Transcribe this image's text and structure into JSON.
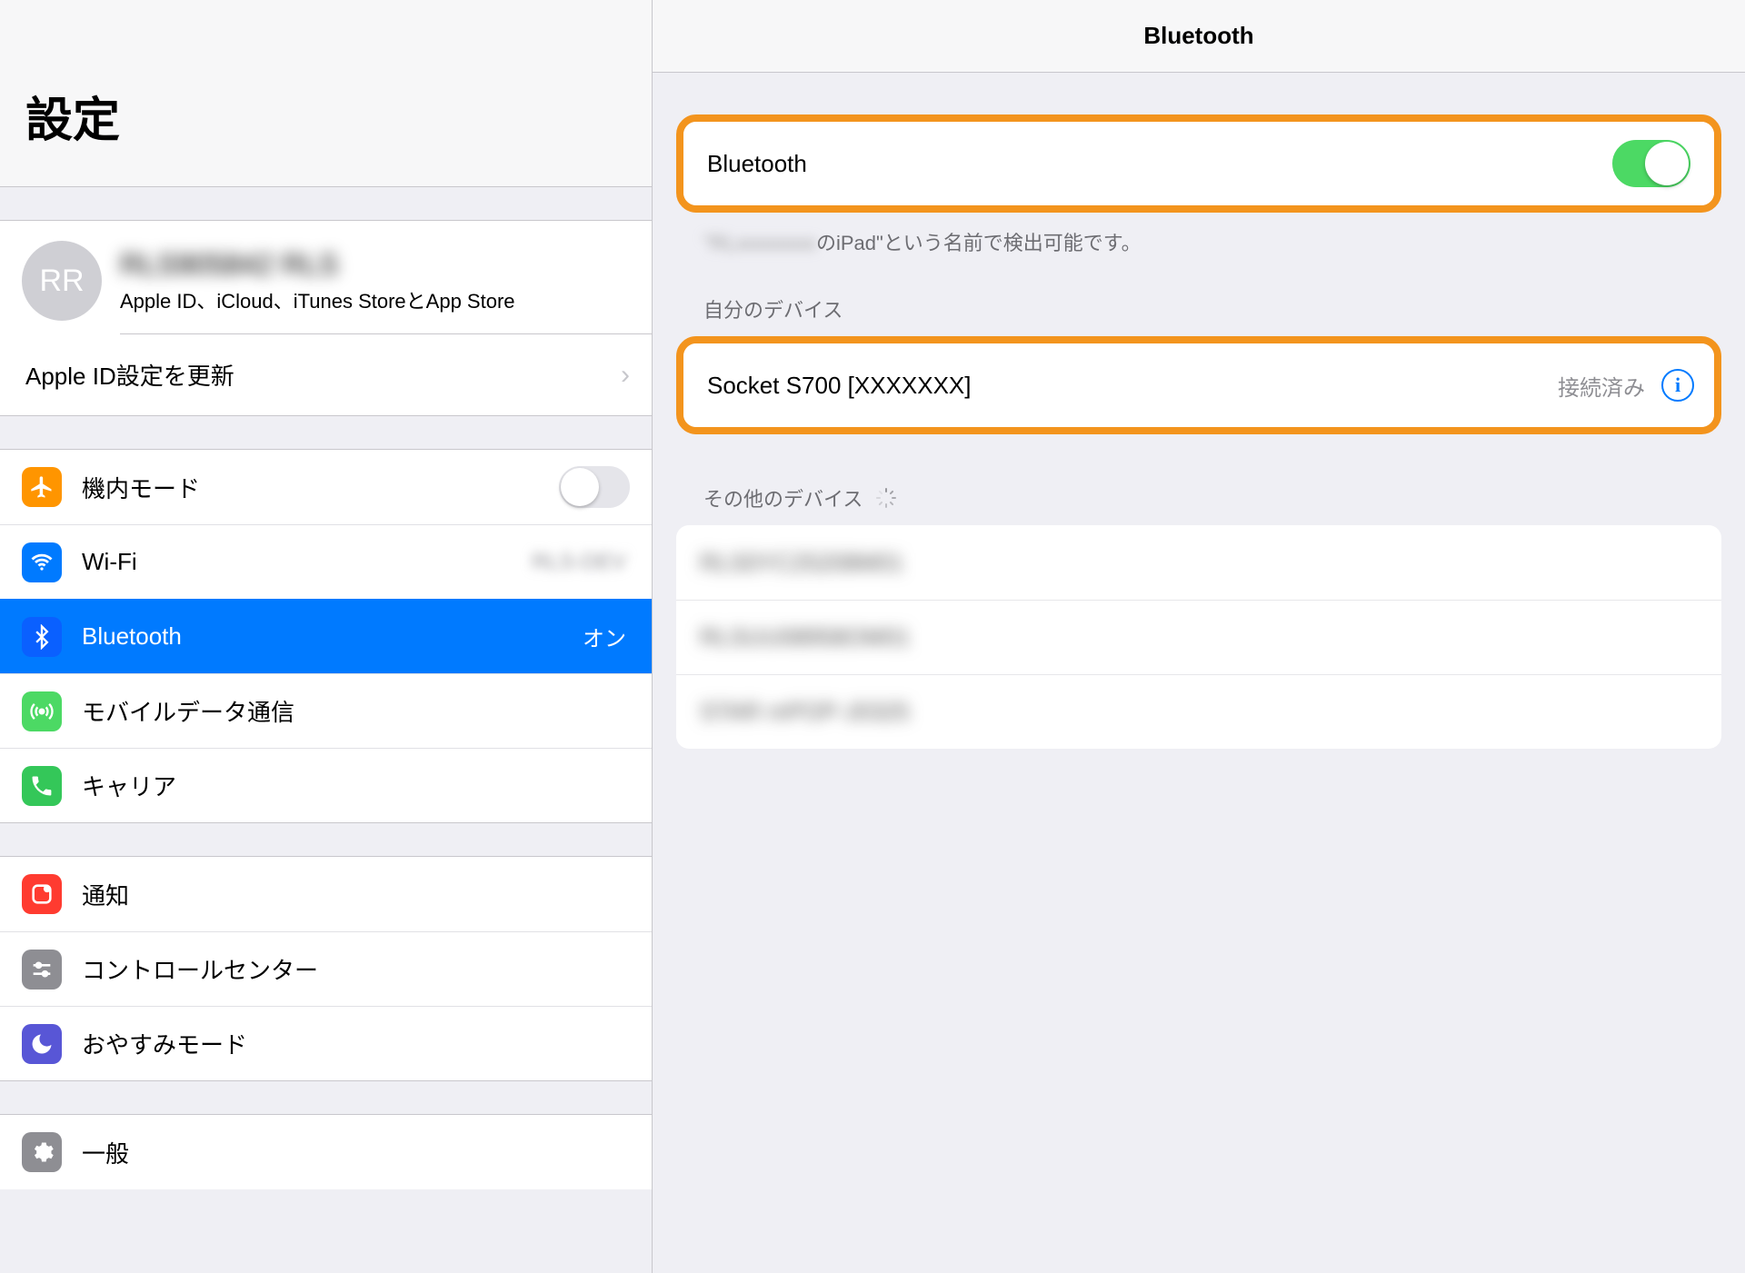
{
  "sidebar": {
    "title": "設定",
    "account": {
      "initials": "RR",
      "name": "RLS905842 RLS",
      "subtitle": "Apple ID、iCloud、iTunes StoreとApp Store",
      "update_label": "Apple ID設定を更新"
    },
    "group1": {
      "airplane": {
        "label": "機内モード",
        "on": false
      },
      "wifi": {
        "label": "Wi-Fi",
        "value": "RLS-DEV"
      },
      "bluetooth": {
        "label": "Bluetooth",
        "value": "オン"
      },
      "cellular": {
        "label": "モバイルデータ通信"
      },
      "carrier": {
        "label": "キャリア"
      }
    },
    "group2": {
      "notifications": {
        "label": "通知"
      },
      "control_center": {
        "label": "コントロールセンター"
      },
      "dnd": {
        "label": "おやすみモード"
      }
    },
    "group3": {
      "general": {
        "label": "一般"
      }
    }
  },
  "main": {
    "title": "Bluetooth",
    "toggle": {
      "label": "Bluetooth",
      "on": true
    },
    "discoverable_blurred": "\"RLxxxxxxxx",
    "discoverable_suffix": "のiPad\"という名前で検出可能です。",
    "my_devices_header": "自分のデバイス",
    "device": {
      "name": "Socket S700 [XXXXXXX]",
      "status": "接続済み"
    },
    "other_header": "その他のデバイス",
    "other_items": [
      "RLS0YC25208M01",
      "RLSUU08958OM01",
      "STAR mPOP-J0325"
    ]
  }
}
